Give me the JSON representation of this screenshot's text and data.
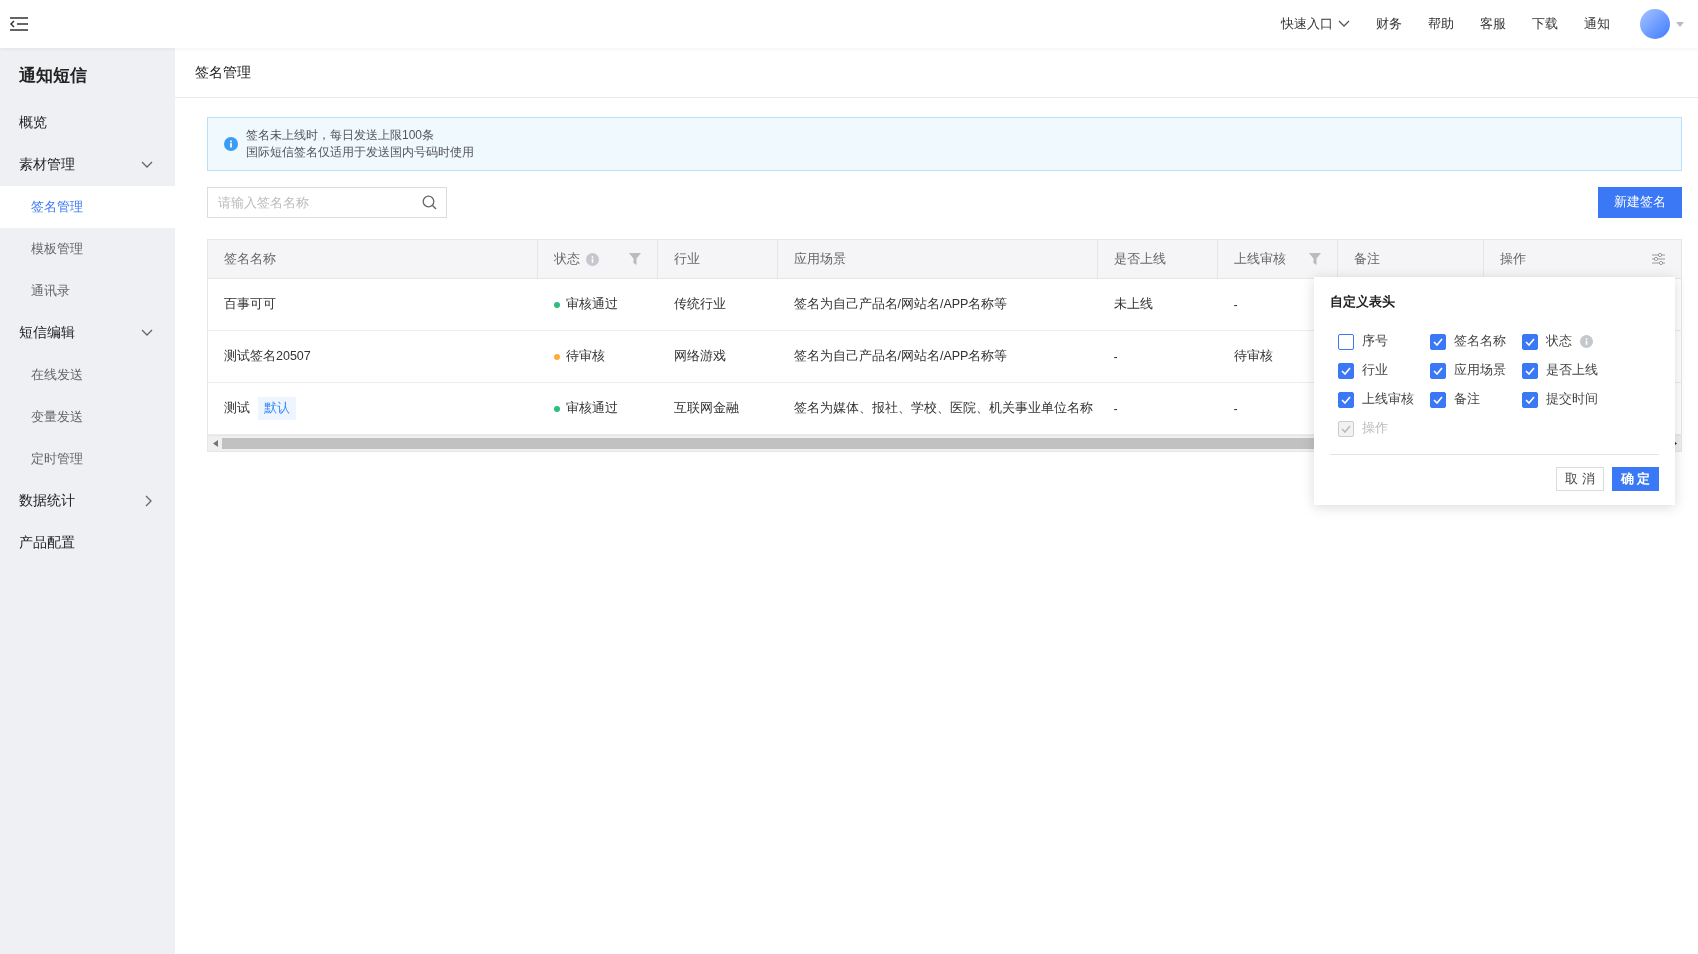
{
  "topbar": {
    "quick_entry": "快速入口",
    "links": [
      "财务",
      "帮助",
      "客服",
      "下载",
      "通知"
    ]
  },
  "sidebar": {
    "title": "通知短信",
    "items": [
      {
        "label": "概览",
        "kind": "link"
      },
      {
        "label": "素材管理",
        "kind": "group",
        "expanded": true,
        "children": [
          {
            "label": "签名管理",
            "selected": true
          },
          {
            "label": "模板管理",
            "selected": false
          },
          {
            "label": "通讯录",
            "selected": false
          }
        ]
      },
      {
        "label": "短信编辑",
        "kind": "group",
        "expanded": true,
        "children": [
          {
            "label": "在线发送",
            "selected": false
          },
          {
            "label": "变量发送",
            "selected": false
          },
          {
            "label": "定时管理",
            "selected": false
          }
        ]
      },
      {
        "label": "数据统计",
        "kind": "group",
        "expanded": false
      },
      {
        "label": "产品配置",
        "kind": "link"
      }
    ]
  },
  "page": {
    "title": "签名管理"
  },
  "alert": {
    "lines": [
      "签名未上线时，每日发送上限100条",
      "国际短信签名仅适用于发送国内号码时使用"
    ]
  },
  "search": {
    "placeholder": "请输入签名名称"
  },
  "new_button": "新建签名",
  "table": {
    "columns": [
      {
        "label": "签名名称",
        "kind": "plain"
      },
      {
        "label": "状态",
        "kind": "info"
      },
      {
        "label": "行业",
        "kind": "plain"
      },
      {
        "label": "应用场景",
        "kind": "plain"
      },
      {
        "label": "是否上线",
        "kind": "plain"
      },
      {
        "label": "上线审核",
        "kind": "filter"
      },
      {
        "label": "备注",
        "kind": "plain"
      },
      {
        "label": "操作",
        "kind": "settings"
      }
    ],
    "rows": [
      {
        "name": "百事可可",
        "status": "审核通过",
        "color": "#2bbf7e",
        "industry": "传统行业",
        "scene": "签名为自己产品名/网站名/APP名称等",
        "online": "未上线",
        "review": "-"
      },
      {
        "name": "测试签名20507",
        "status": "待审核",
        "color": "#ffa940",
        "industry": "网络游戏",
        "scene": "签名为自己产品名/网站名/APP名称等",
        "online": "-",
        "review": "待审核"
      },
      {
        "name": "测试",
        "tag": "默认",
        "status": "审核通过",
        "color": "#2bbf7e",
        "industry": "互联网金融",
        "scene": "签名为媒体、报社、学校、医院、机关事业单位名称",
        "online": "-",
        "review": "-"
      }
    ]
  },
  "popover": {
    "title": "自定义表头",
    "options": [
      {
        "label": "序号",
        "checked": false,
        "disabled": false,
        "kind": "plain"
      },
      {
        "label": "签名名称",
        "checked": true,
        "disabled": false,
        "kind": "plain"
      },
      {
        "label": "状态",
        "checked": true,
        "disabled": false,
        "kind": "info"
      },
      {
        "label": "行业",
        "checked": true,
        "disabled": false,
        "kind": "plain"
      },
      {
        "label": "应用场景",
        "checked": true,
        "disabled": false,
        "kind": "plain"
      },
      {
        "label": "是否上线",
        "checked": true,
        "disabled": false,
        "kind": "plain"
      },
      {
        "label": "上线审核",
        "checked": true,
        "disabled": false,
        "kind": "plain"
      },
      {
        "label": "备注",
        "checked": true,
        "disabled": false,
        "kind": "plain"
      },
      {
        "label": "提交时间",
        "checked": true,
        "disabled": false,
        "kind": "plain"
      },
      {
        "label": "操作",
        "checked": true,
        "disabled": true,
        "kind": "plain"
      }
    ],
    "cancel": "取 消",
    "confirm": "确 定"
  }
}
